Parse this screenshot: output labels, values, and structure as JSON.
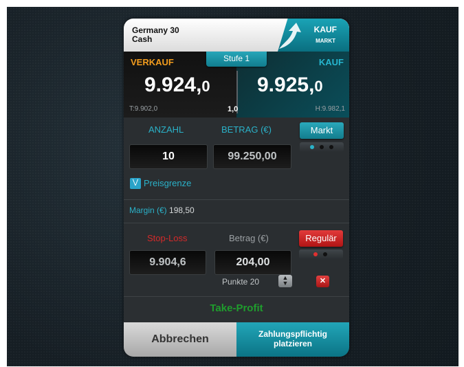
{
  "header": {
    "instrument_line1": "Germany 30",
    "instrument_line2": "Cash",
    "direction": "KAUF",
    "order_type": "MARKT"
  },
  "prices": {
    "sell_label": "VERKAUF",
    "buy_label": "KAUF",
    "level_tab": "Stufe 1",
    "sell_main": "9.924,",
    "sell_decimal": "0",
    "buy_main": "9.925,",
    "buy_decimal": "0",
    "low": "T:9.902,0",
    "spread": "1,0",
    "high": "H:9.982,1"
  },
  "order": {
    "quantity_label": "ANZAHL",
    "amount_label": "BETRAG (€)",
    "quantity_value": "10",
    "amount_value": "99.250,00",
    "mode_button": "Markt",
    "limit_label": "Preisgrenze"
  },
  "margin": {
    "label": "Margin (€)",
    "value": "198,50"
  },
  "stop": {
    "label": "Stop-Loss",
    "amount_label": "Betrag (€)",
    "mode_button": "Regulär",
    "price_value": "9.904,6",
    "amount_value": "204,00",
    "points_label": "Punkte",
    "points_value": "20"
  },
  "take_profit": {
    "label": "Take-Profit"
  },
  "footer": {
    "cancel": "Abbrechen",
    "place_line1": "Zahlungspflichtig",
    "place_line2": "platzieren"
  },
  "colors": {
    "accent": "#2ab2c9",
    "sell": "#f29c1e",
    "stop": "#d42a2a",
    "take_profit": "#1f9d2d"
  },
  "icons": [
    "arrow-up-right-icon",
    "chevron-down-icon",
    "up-down-stepper-icon",
    "close-icon"
  ]
}
